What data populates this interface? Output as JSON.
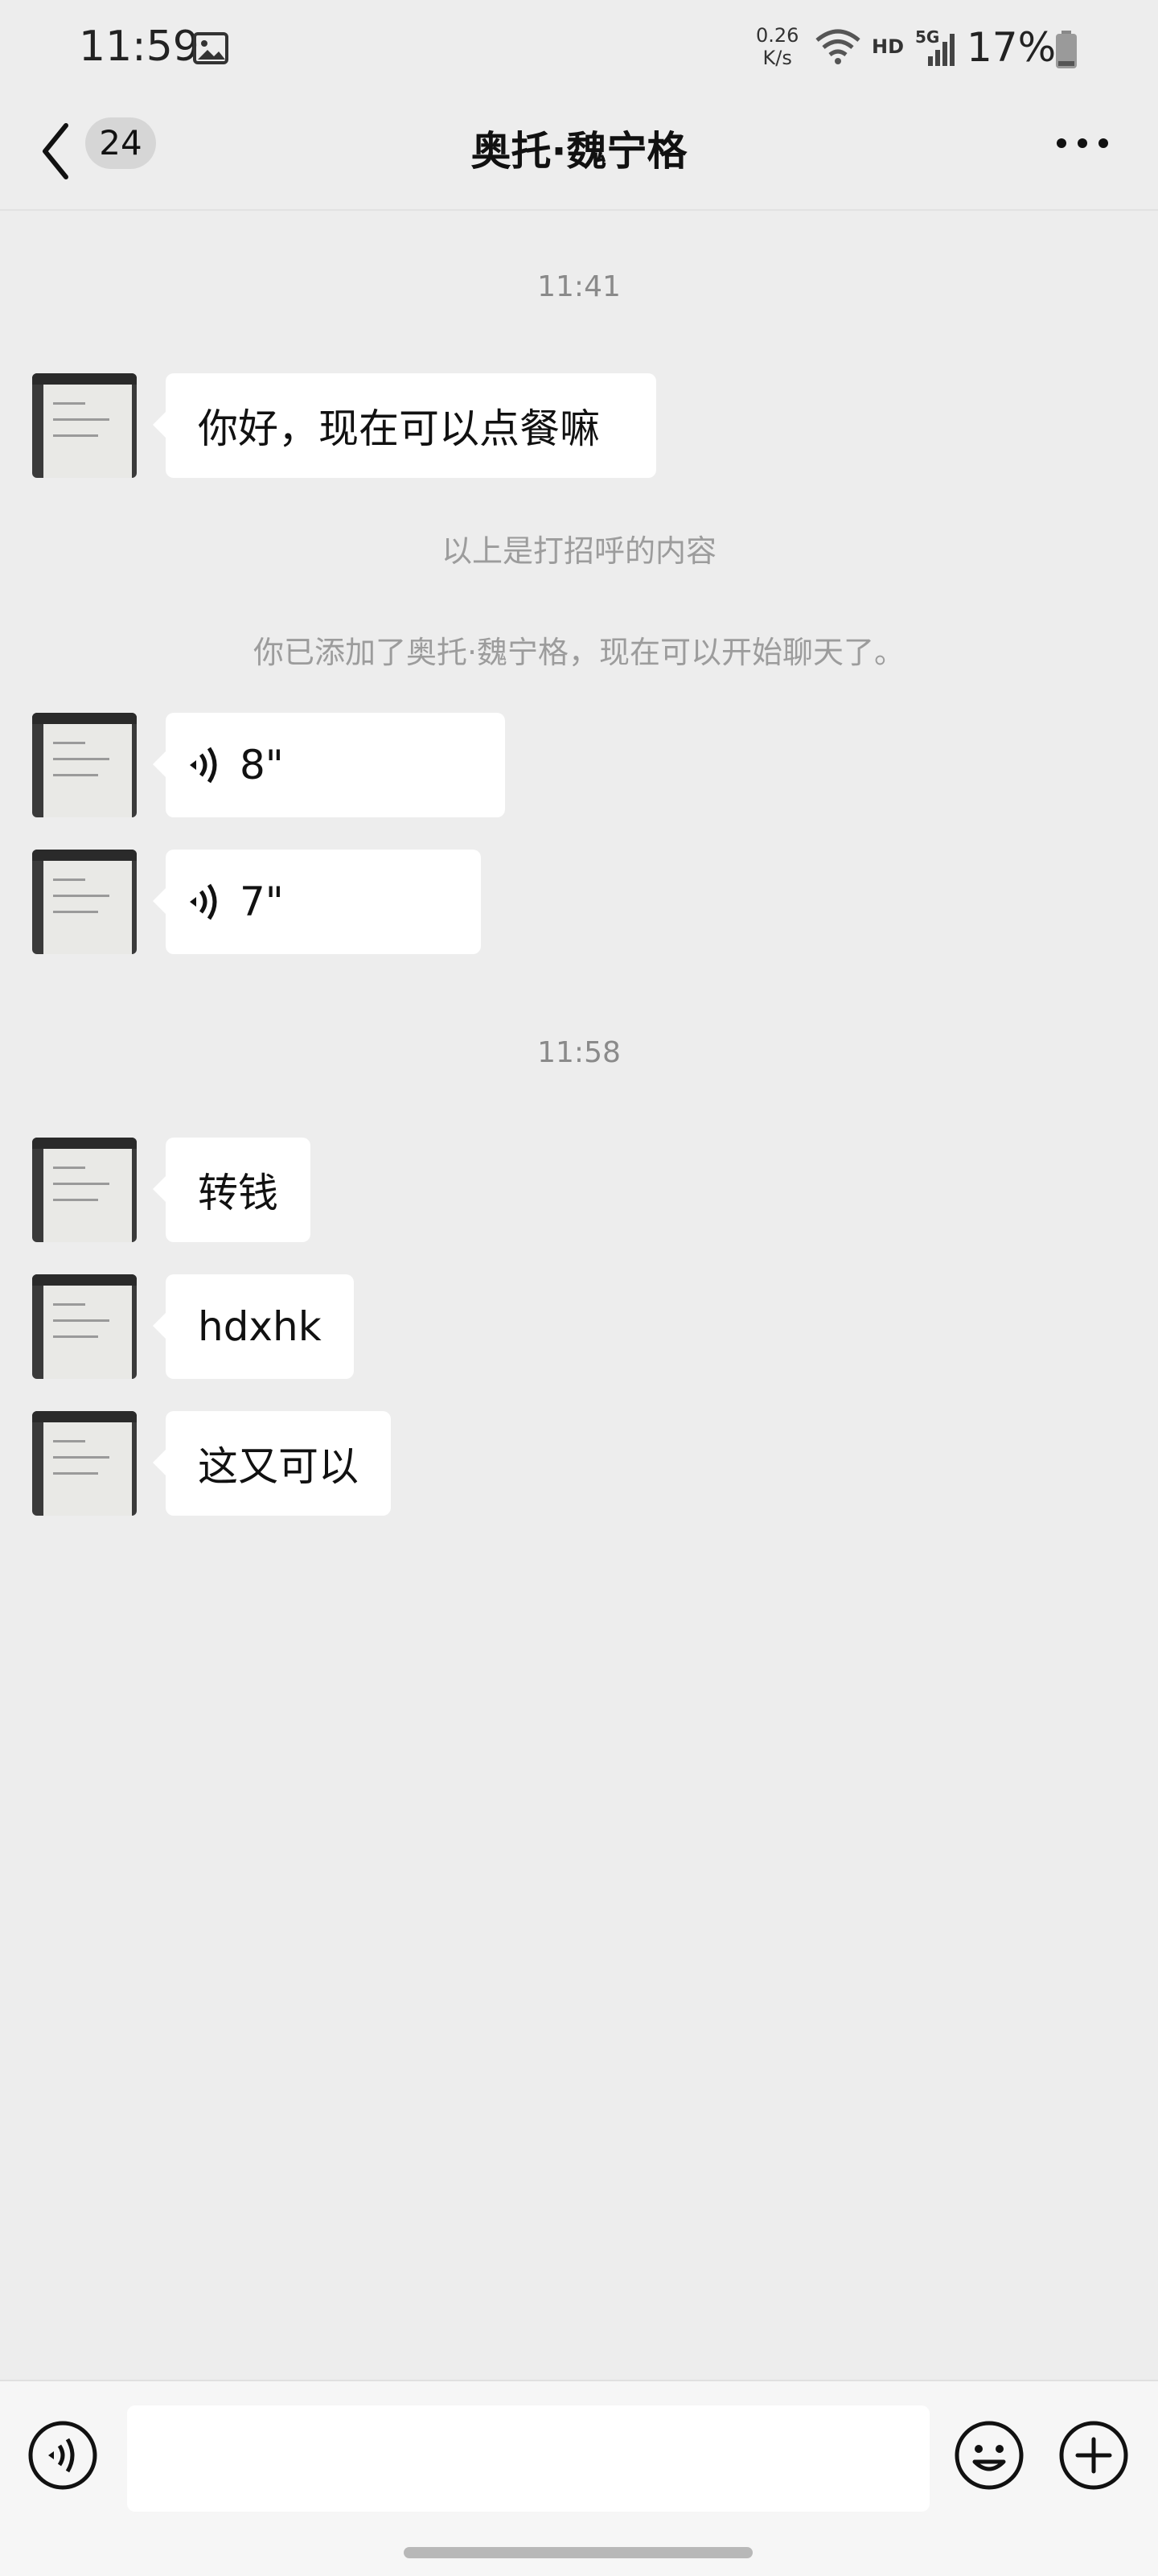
{
  "status_bar": {
    "time": "11:59",
    "net_speed_value": "0.26",
    "net_speed_unit": "K/s",
    "hd": "HD",
    "network": "5G",
    "battery_percent": "17%"
  },
  "header": {
    "unread_count": "24",
    "title": "奥托·魏宁格"
  },
  "messages": {
    "time_1": "11:41",
    "greeting": "你好，现在可以点餐嘛",
    "system_1": "以上是打招呼的内容",
    "system_2": "你已添加了奥托·魏宁格，现在可以开始聊天了。",
    "voice_1_duration": "8\"",
    "voice_2_duration": "7\"",
    "time_2": "11:58",
    "msg_1": "转钱",
    "msg_2": "hdxhk",
    "msg_3": "这又可以"
  },
  "colors": {
    "background": "#ededed",
    "bubble": "#ffffff",
    "system_text": "#9c9c9c"
  },
  "icons": [
    "image-icon",
    "wifi-icon",
    "signal-icon",
    "battery-icon",
    "back-icon",
    "more-icon",
    "voice-icon",
    "emoji-icon",
    "plus-icon"
  ]
}
